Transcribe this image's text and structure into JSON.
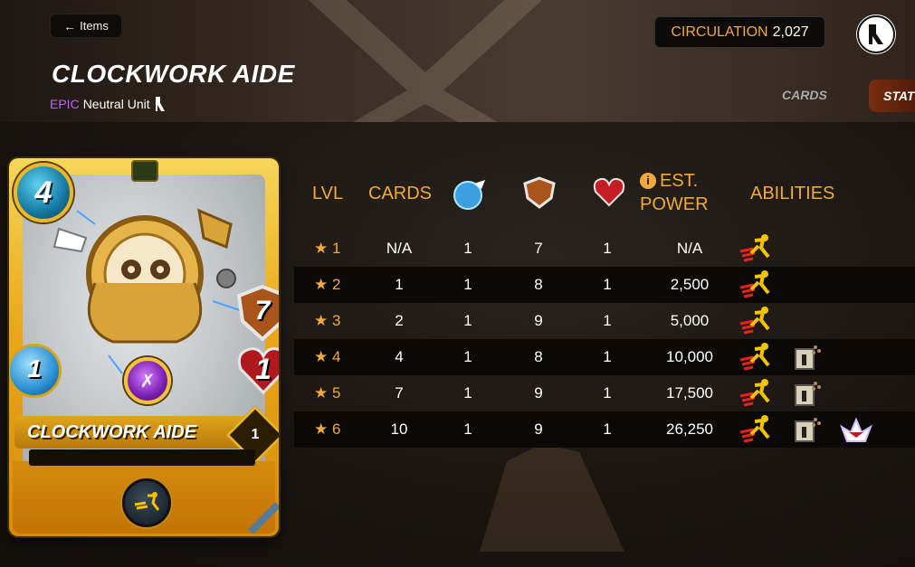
{
  "header": {
    "back_label": "Items",
    "title": "CLOCKWORK AIDE",
    "rarity": "EPIC",
    "unit_type": "Neutral Unit",
    "circulation_label": "CIRCULATION",
    "circulation_value": "2,027",
    "tabs": {
      "cards": "CARDS",
      "stats": "STATS"
    }
  },
  "card": {
    "mana": "4",
    "armor": "7",
    "health": "1",
    "speed": "1",
    "name": "CLOCKWORK AIDE",
    "level": "1"
  },
  "table": {
    "headers": {
      "lvl": "LVL",
      "cards": "CARDS",
      "speed_icon": "speed-icon",
      "armor_icon": "armor-icon",
      "health_icon": "health-icon",
      "power_line1": "EST.",
      "power_line2": "POWER",
      "abilities": "ABILITIES"
    },
    "rows": [
      {
        "lvl": "★ 1",
        "cards": "N/A",
        "speed": "1",
        "armor": "7",
        "health": "1",
        "power": "N/A",
        "abilities": [
          "swiftness"
        ]
      },
      {
        "lvl": "★ 2",
        "cards": "1",
        "speed": "1",
        "armor": "8",
        "health": "1",
        "power": "2,500",
        "abilities": [
          "swiftness"
        ]
      },
      {
        "lvl": "★ 3",
        "cards": "2",
        "speed": "1",
        "armor": "9",
        "health": "1",
        "power": "5,000",
        "abilities": [
          "swiftness"
        ]
      },
      {
        "lvl": "★ 4",
        "cards": "4",
        "speed": "1",
        "armor": "8",
        "health": "1",
        "power": "10,000",
        "abilities": [
          "swiftness",
          "repair"
        ]
      },
      {
        "lvl": "★ 5",
        "cards": "7",
        "speed": "1",
        "armor": "9",
        "health": "1",
        "power": "17,500",
        "abilities": [
          "swiftness",
          "repair"
        ]
      },
      {
        "lvl": "★ 6",
        "cards": "10",
        "speed": "1",
        "armor": "9",
        "health": "1",
        "power": "26,250",
        "abilities": [
          "swiftness",
          "repair",
          "divine-shield"
        ]
      }
    ]
  },
  "colors": {
    "accent": "#f2a93a",
    "rarity_epic": "#c45cff",
    "header_bg": "#3a2e25"
  }
}
